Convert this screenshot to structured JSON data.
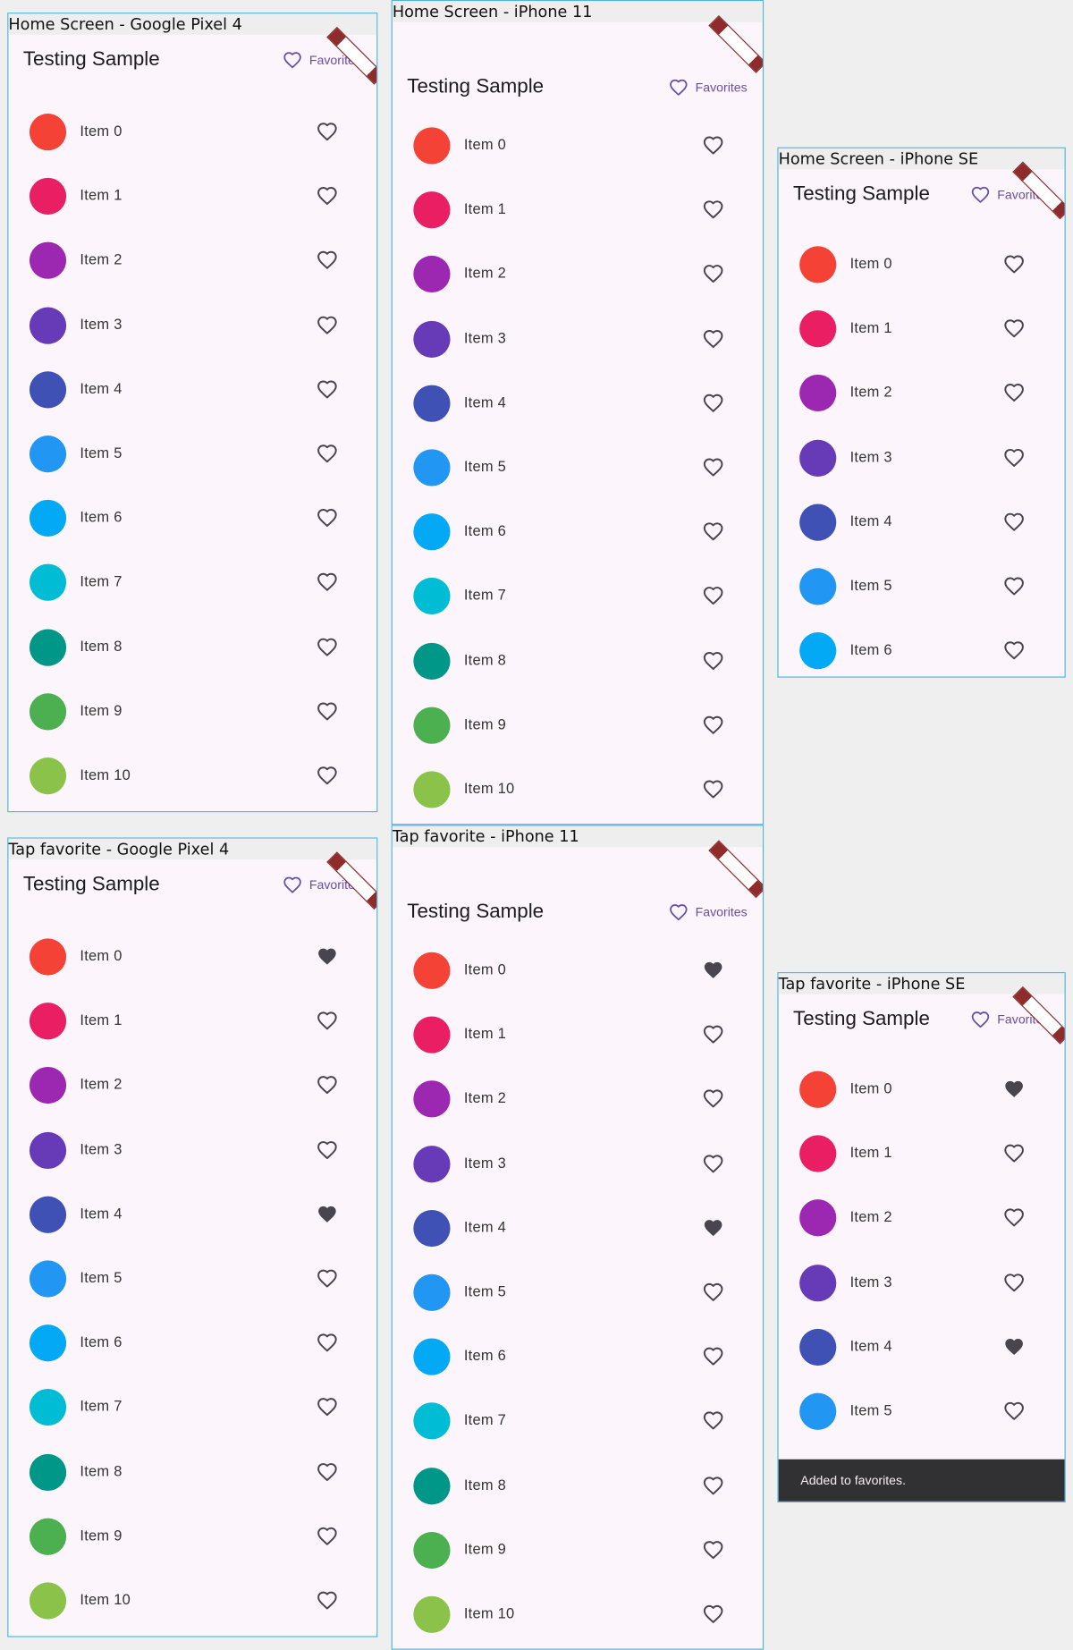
{
  "app_title": "Testing Sample",
  "favorites_label": "Favorites",
  "frames": [
    {
      "caption": "Home Screen - Google Pixel 4",
      "filled": [],
      "items": [
        "Item 0",
        "Item 1",
        "Item 2",
        "Item 3",
        "Item 4",
        "Item 5",
        "Item 6",
        "Item 7",
        "Item 8",
        "Item 9",
        "Item 10"
      ]
    },
    {
      "caption": "Home Screen - iPhone 11",
      "filled": [],
      "items": [
        "Item 0",
        "Item 1",
        "Item 2",
        "Item 3",
        "Item 4",
        "Item 5",
        "Item 6",
        "Item 7",
        "Item 8",
        "Item 9",
        "Item 10"
      ]
    },
    {
      "caption": "Home Screen - iPhone SE",
      "filled": [],
      "items": [
        "Item 0",
        "Item 1",
        "Item 2",
        "Item 3",
        "Item 4",
        "Item 5",
        "Item 6"
      ]
    },
    {
      "caption": "Tap favorite - Google Pixel 4",
      "filled": [
        0,
        4
      ],
      "items": [
        "Item 0",
        "Item 1",
        "Item 2",
        "Item 3",
        "Item 4",
        "Item 5",
        "Item 6",
        "Item 7",
        "Item 8",
        "Item 9",
        "Item 10"
      ]
    },
    {
      "caption": "Tap favorite - iPhone 11",
      "filled": [
        0,
        4
      ],
      "items": [
        "Item 0",
        "Item 1",
        "Item 2",
        "Item 3",
        "Item 4",
        "Item 5",
        "Item 6",
        "Item 7",
        "Item 8",
        "Item 9",
        "Item 10"
      ]
    },
    {
      "caption": "Tap favorite - iPhone SE",
      "filled": [
        0,
        4
      ],
      "items": [
        "Item 0",
        "Item 1",
        "Item 2",
        "Item 3",
        "Item 4",
        "Item 5"
      ],
      "snackbar": "Added to favorites."
    }
  ],
  "avatar_colors": [
    "#f44336",
    "#e91e63",
    "#9c27b0",
    "#673ab7",
    "#3f51b5",
    "#2196f3",
    "#03a9f4",
    "#00bcd4",
    "#009688",
    "#4caf50",
    "#8bc34a"
  ],
  "colors": {
    "accent": "#6750a4",
    "heart": "#49454f",
    "background": "#fcf5fb",
    "frame_border": "#4db6dc"
  },
  "icons": {
    "favorites": "heart-outline-icon",
    "item_outline": "heart-outline-icon",
    "item_filled": "heart-filled-icon"
  }
}
